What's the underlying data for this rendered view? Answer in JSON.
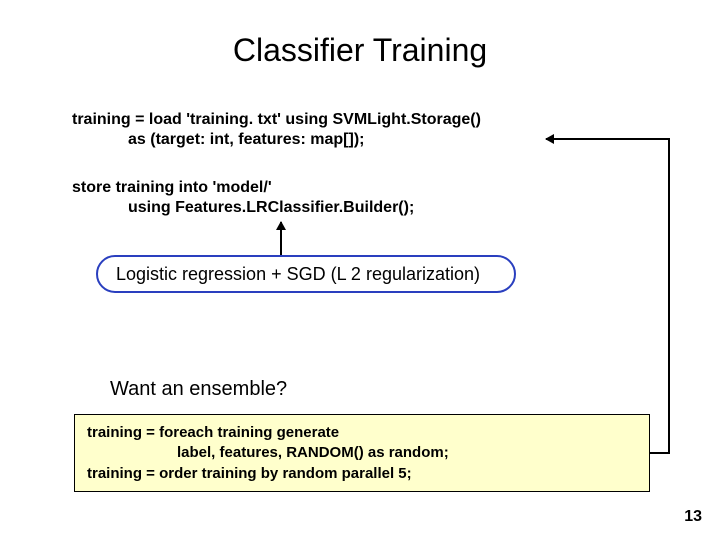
{
  "title": "Classifier Training",
  "code1": {
    "line1": "training = load 'training. txt' using SVMLight.Storage()",
    "line2": "as (target: int, features: map[]);"
  },
  "code2": {
    "line1": "store training into 'model/'",
    "line2": "using Features.LRClassifier.Builder();"
  },
  "bubble": "Logistic regression + SGD (L 2 regularization)",
  "question": "Want an ensemble?",
  "box": {
    "line1": "training = foreach training generate",
    "line2": "label, features, RANDOM() as random;",
    "line3": "training = order training by random parallel 5;"
  },
  "pageno": "13"
}
